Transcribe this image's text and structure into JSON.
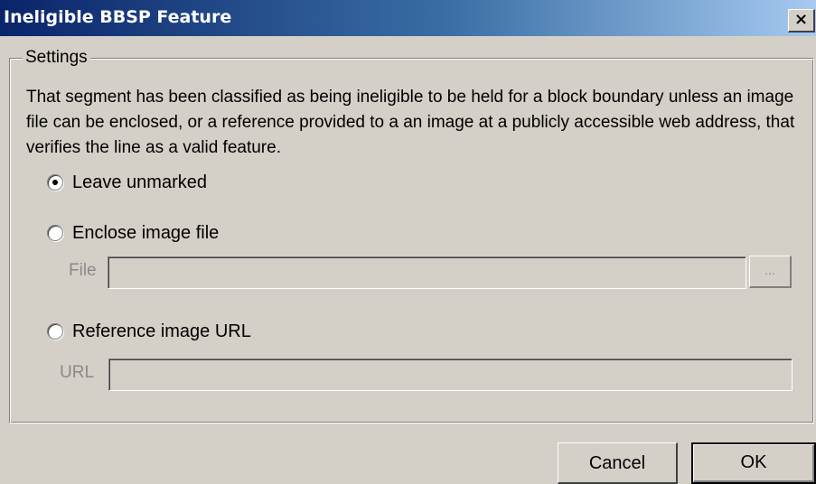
{
  "window": {
    "title": "Ineligible BBSP Feature",
    "close_glyph": "×"
  },
  "settings": {
    "legend": "Settings",
    "description": "That segment has been classified as being ineligible to be held for a block boundary unless an image file can be enclosed, or a reference provided to a an image at a publicly accessible web address, that verifies the line as a valid feature.",
    "options": [
      {
        "label": "Leave unmarked",
        "checked": true
      },
      {
        "label": "Enclose image file",
        "checked": false
      },
      {
        "label": "Reference image URL",
        "checked": false
      }
    ],
    "file": {
      "label": "File",
      "value": "",
      "browse_label": "..."
    },
    "url": {
      "label": "URL",
      "value": ""
    }
  },
  "buttons": {
    "cancel": "Cancel",
    "ok": "OK"
  }
}
